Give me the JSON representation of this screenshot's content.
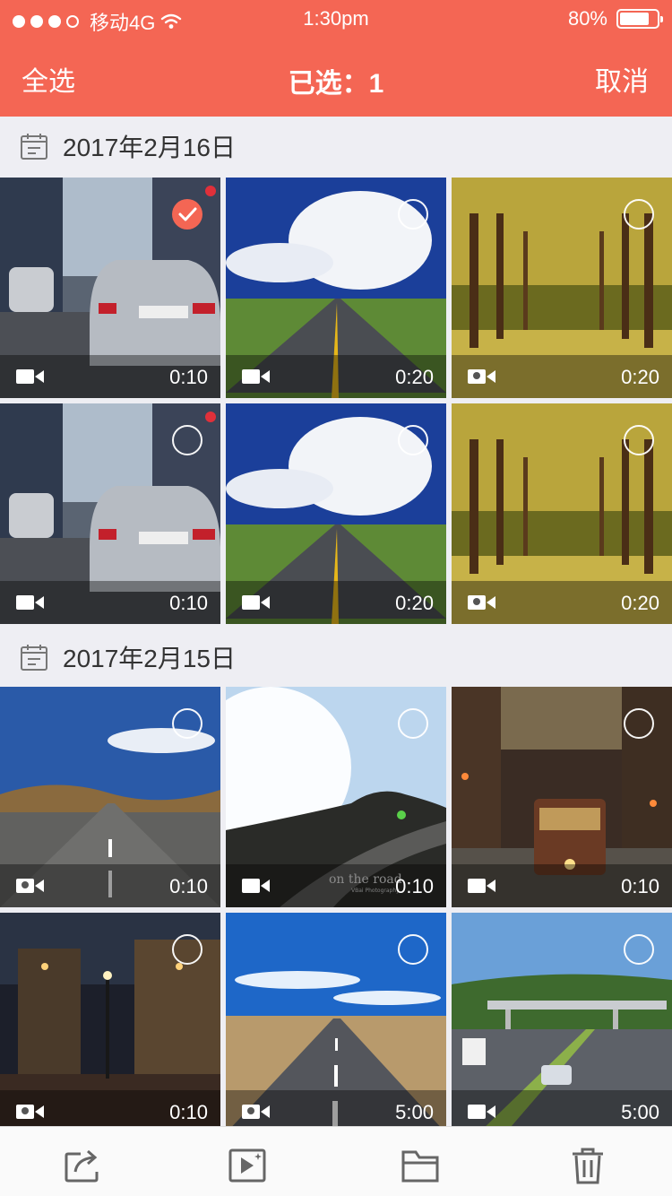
{
  "status_bar": {
    "carrier": "移动4G",
    "time": "1:30pm",
    "battery": "80%",
    "battery_level": 0.8
  },
  "nav": {
    "select_all": "全选",
    "title": "已选：1",
    "cancel": "取消"
  },
  "sections": [
    {
      "date": "2017年2月16日",
      "items": [
        {
          "duration": "0:10",
          "type": "video-icon",
          "checked": true
        },
        {
          "duration": "0:20",
          "type": "video-icon",
          "checked": false
        },
        {
          "duration": "0:20",
          "type": "gps-video-icon",
          "checked": false
        },
        {
          "duration": "0:10",
          "type": "video-icon",
          "checked": false
        },
        {
          "duration": "0:20",
          "type": "video-icon",
          "checked": false
        },
        {
          "duration": "0:20",
          "type": "gps-video-icon",
          "checked": false
        }
      ]
    },
    {
      "date": "2017年2月15日",
      "items": [
        {
          "duration": "0:10",
          "type": "gps-video-icon",
          "checked": false
        },
        {
          "duration": "0:10",
          "type": "video-icon",
          "checked": false,
          "caption": "on the road",
          "caption_sub": "VBai Photography"
        },
        {
          "duration": "0:10",
          "type": "video-icon",
          "checked": false
        },
        {
          "duration": "0:10",
          "type": "gps-video-icon",
          "checked": false
        },
        {
          "duration": "5:00",
          "type": "gps-video-icon",
          "checked": false
        },
        {
          "duration": "5:00",
          "type": "video-icon",
          "checked": false
        }
      ]
    }
  ],
  "toolbar": [
    "share-icon",
    "video-edit-icon",
    "folder-icon",
    "trash-icon"
  ],
  "colors": {
    "accent": "#f46654",
    "background": "#eeeef3"
  }
}
